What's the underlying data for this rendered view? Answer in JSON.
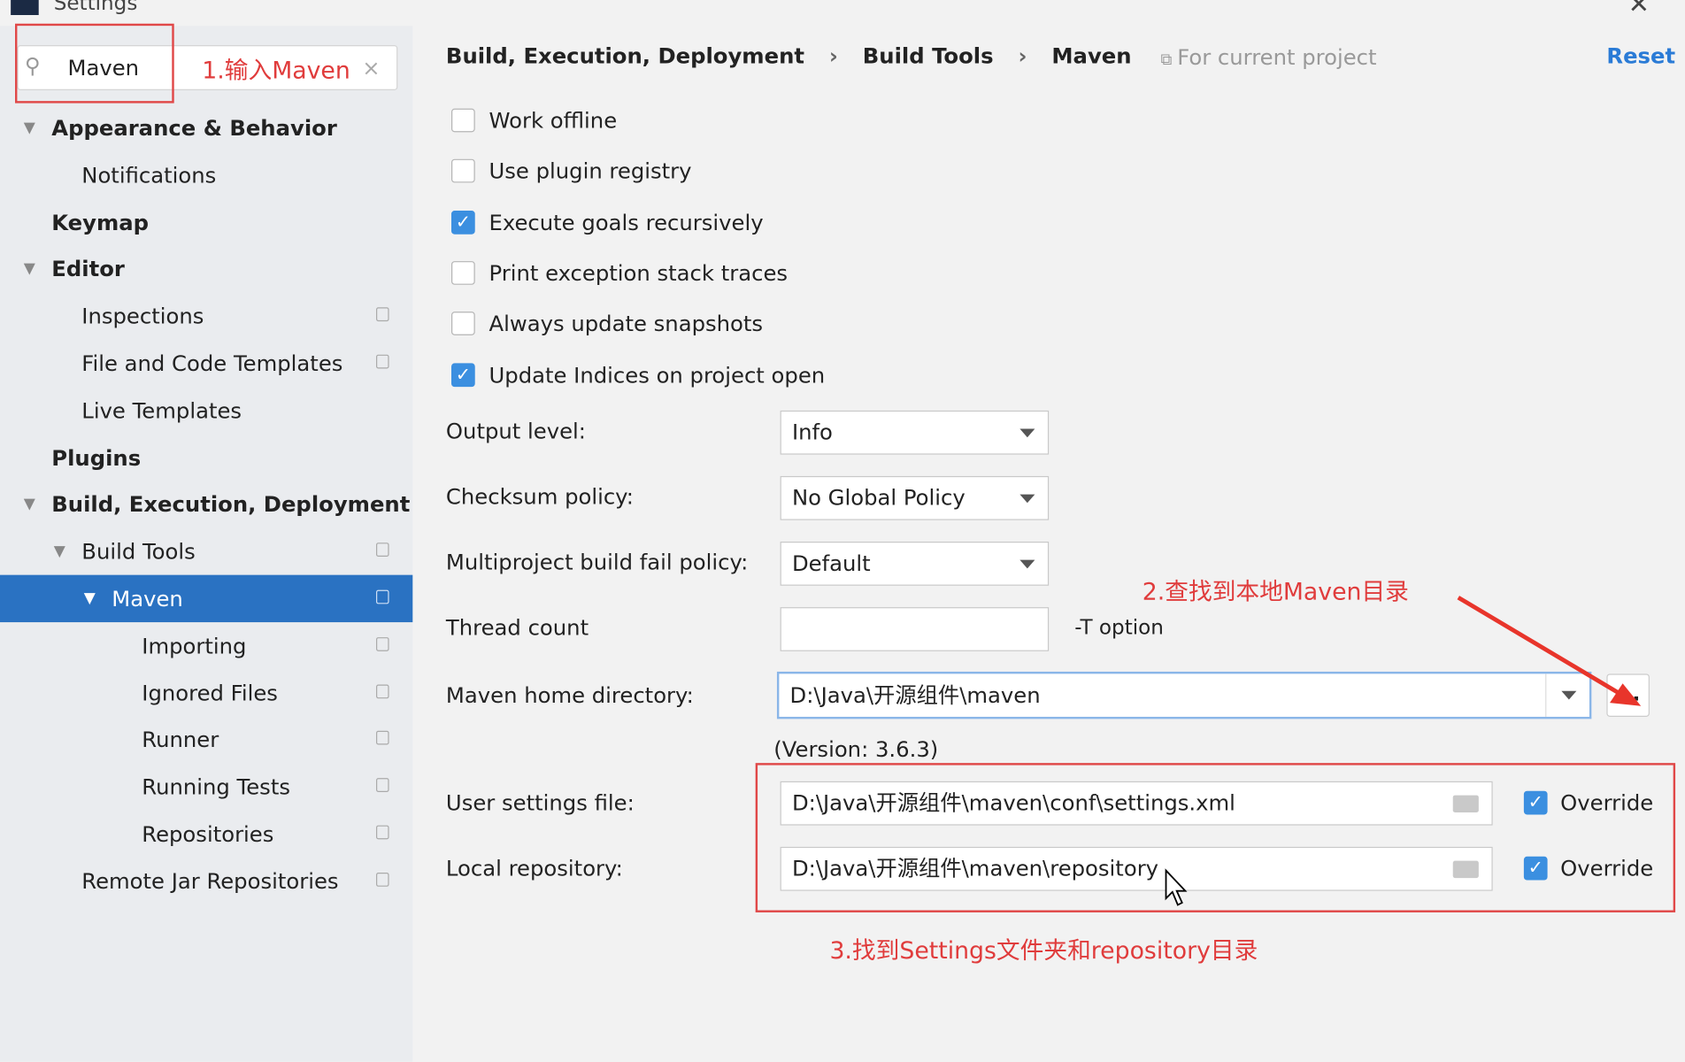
{
  "window": {
    "title": "Settings",
    "close_icon": "close-icon"
  },
  "search": {
    "value": "Maven",
    "annotation": "1.输入Maven"
  },
  "sidebar": {
    "items": [
      {
        "label": "Appearance & Behavior",
        "level": 0,
        "bold": true,
        "expanded": true
      },
      {
        "label": "Notifications",
        "level": 1
      },
      {
        "label": "Keymap",
        "level": 0,
        "bold": true
      },
      {
        "label": "Editor",
        "level": 0,
        "bold": true,
        "expanded": true
      },
      {
        "label": "Inspections",
        "level": 1,
        "project": true
      },
      {
        "label": "File and Code Templates",
        "level": 1,
        "project": true
      },
      {
        "label": "Live Templates",
        "level": 1
      },
      {
        "label": "Plugins",
        "level": 0,
        "bold": true
      },
      {
        "label": "Build, Execution, Deployment",
        "level": 0,
        "bold": true,
        "expanded": true
      },
      {
        "label": "Build Tools",
        "level": 1,
        "expanded": true,
        "project": true
      },
      {
        "label": "Maven",
        "level": 2,
        "expanded": true,
        "selected": true,
        "project": true
      },
      {
        "label": "Importing",
        "level": 3,
        "project": true
      },
      {
        "label": "Ignored Files",
        "level": 3,
        "project": true
      },
      {
        "label": "Runner",
        "level": 3,
        "project": true
      },
      {
        "label": "Running Tests",
        "level": 3,
        "project": true
      },
      {
        "label": "Repositories",
        "level": 3,
        "project": true
      },
      {
        "label": "Remote Jar Repositories",
        "level": 1,
        "project": true
      }
    ]
  },
  "breadcrumb": {
    "items": [
      "Build, Execution, Deployment",
      "Build Tools",
      "Maven"
    ],
    "sep": "›",
    "scope": "For current project",
    "reset": "Reset"
  },
  "checkboxes": [
    {
      "label": "Work offline",
      "checked": false
    },
    {
      "label": "Use plugin registry",
      "checked": false
    },
    {
      "label": "Execute goals recursively",
      "checked": true
    },
    {
      "label": "Print exception stack traces",
      "checked": false
    },
    {
      "label": "Always update snapshots",
      "checked": false
    },
    {
      "label": "Update Indices on project open",
      "checked": true
    }
  ],
  "form": {
    "output_level": {
      "label": "Output level:",
      "value": "Info"
    },
    "checksum": {
      "label": "Checksum policy:",
      "value": "No Global Policy"
    },
    "multiproject": {
      "label": "Multiproject build fail policy:",
      "value": "Default"
    },
    "thread_count": {
      "label": "Thread count",
      "value": "",
      "suffix": "-T option"
    },
    "maven_home": {
      "label": "Maven home directory:",
      "value": "D:\\Java\\开源组件\\maven",
      "browse": "...",
      "version": "(Version: 3.6.3)"
    },
    "user_settings": {
      "label": "User settings file:",
      "value": "D:\\Java\\开源组件\\maven\\conf\\settings.xml",
      "override": "Override",
      "override_checked": true
    },
    "local_repo": {
      "label": "Local repository:",
      "value": "D:\\Java\\开源组件\\maven\\repository",
      "override": "Override",
      "override_checked": true
    }
  },
  "annotations": {
    "step2": "2.查找到本地Maven目录",
    "step3": "3.找到Settings文件夹和repository目录",
    "color": "#e03c3c"
  },
  "colors": {
    "accent": "#2a72c2",
    "link": "#2a7bd6"
  }
}
